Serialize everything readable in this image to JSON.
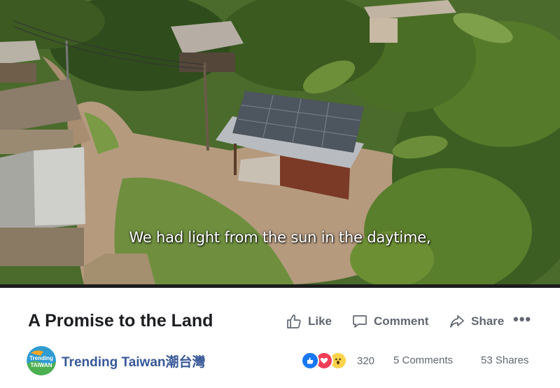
{
  "video": {
    "subtitle": "We had light from the sun in the daytime,"
  },
  "post": {
    "title": "A Promise to the Land",
    "actions": {
      "like": "Like",
      "comment": "Comment",
      "share": "Share",
      "more": "•••"
    },
    "page": {
      "name": "Trending Taiwan潮台灣",
      "avatar_text": [
        "Trending",
        "TAIWAN"
      ]
    },
    "stats": {
      "reaction_count": "320",
      "comments": "5 Comments",
      "shares": "53 Shares"
    },
    "reaction_icons": [
      "like-icon",
      "love-icon",
      "wow-icon"
    ]
  },
  "colors": {
    "link": "#385898",
    "meta": "#606770",
    "title": "#1c1e21",
    "like_blue": "#1877f2",
    "love_red": "#f33e58",
    "wow_yellow": "#fcd34d"
  }
}
